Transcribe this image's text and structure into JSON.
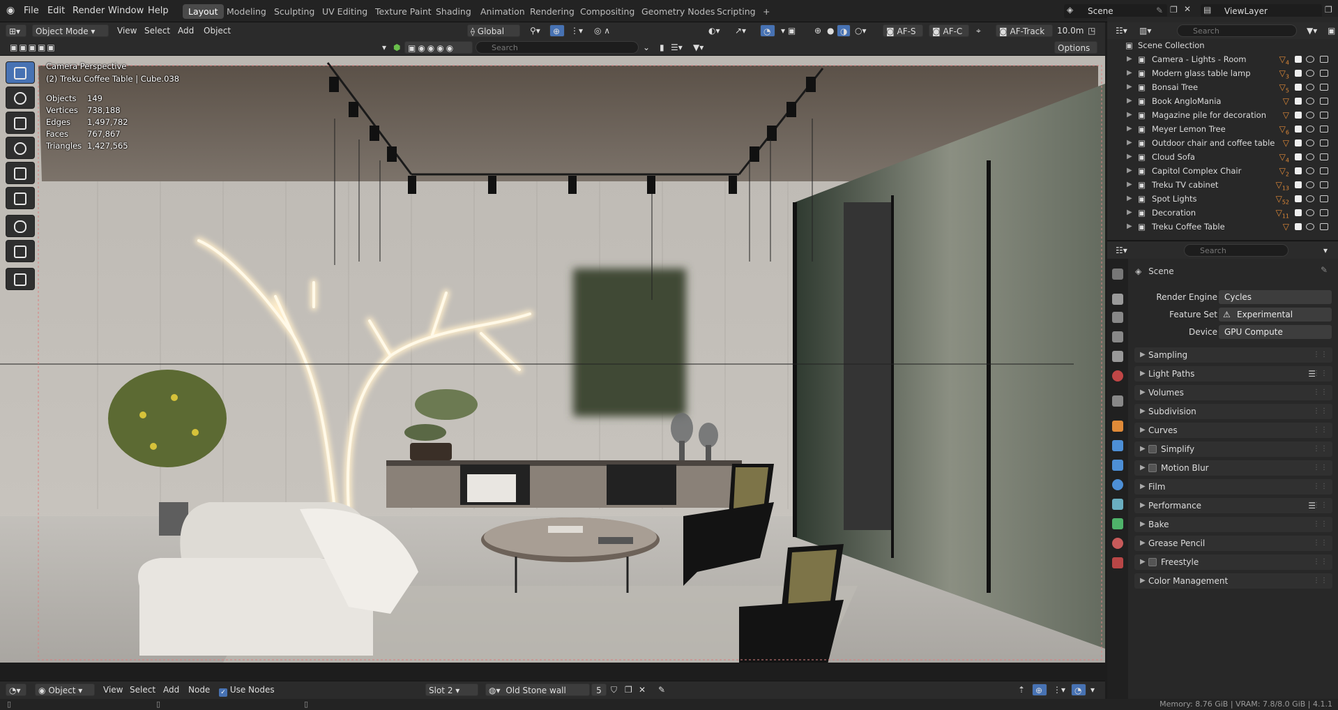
{
  "menu": {
    "file": "File",
    "edit": "Edit",
    "render": "Render",
    "window": "Window",
    "help": "Help"
  },
  "workspaces": [
    "Layout",
    "Modeling",
    "Sculpting",
    "UV Editing",
    "Texture Paint",
    "Shading",
    "Animation",
    "Rendering",
    "Compositing",
    "Geometry Nodes",
    "Scripting"
  ],
  "workspace_add": "+",
  "scene": {
    "label": "Scene",
    "viewlayer": "ViewLayer"
  },
  "viewport_header": {
    "mode": "Object Mode",
    "view": "View",
    "select": "Select",
    "add": "Add",
    "object": "Object",
    "transform": "Global",
    "af_s": "AF-S",
    "af_c": "AF-C",
    "af_track": "AF-Track",
    "distance": "10.0m",
    "search_placeholder": "Search",
    "options": "Options"
  },
  "overlay_info": {
    "camera": "Camera Perspective",
    "active": "(2) Treku Coffee Table | Cube.038",
    "stats": [
      {
        "label": "Objects",
        "value": "149"
      },
      {
        "label": "Vertices",
        "value": "738,188"
      },
      {
        "label": "Edges",
        "value": "1,497,782"
      },
      {
        "label": "Faces",
        "value": "767,867"
      },
      {
        "label": "Triangles",
        "value": "1,427,565"
      }
    ]
  },
  "outliner": {
    "search_placeholder": "Search",
    "root": "Scene Collection",
    "items": [
      {
        "name": "Camera - Lights - Room",
        "badge": "4"
      },
      {
        "name": "Modern glass table lamp",
        "badge": "3"
      },
      {
        "name": "Bonsai Tree",
        "badge": "5"
      },
      {
        "name": "Book AngloMania",
        "badge": ""
      },
      {
        "name": "Magazine pile for decoration",
        "badge": ""
      },
      {
        "name": "Meyer Lemon Tree",
        "badge": "6"
      },
      {
        "name": "Outdoor chair and coffee table",
        "badge": ""
      },
      {
        "name": "Cloud Sofa",
        "badge": "4"
      },
      {
        "name": "Capitol Complex Chair",
        "badge": "2"
      },
      {
        "name": "Treku TV cabinet",
        "badge": "13"
      },
      {
        "name": "Spot Lights",
        "badge": "52"
      },
      {
        "name": "Decoration",
        "badge": "11"
      },
      {
        "name": "Treku Coffee Table",
        "badge": ""
      }
    ]
  },
  "properties": {
    "search_placeholder": "Search",
    "context": "Scene",
    "fields": [
      {
        "label": "Render Engine",
        "value": "Cycles"
      },
      {
        "label": "Feature Set",
        "value": "Experimental"
      },
      {
        "label": "Device",
        "value": "GPU Compute"
      }
    ],
    "panels": [
      {
        "name": "Sampling",
        "check": false,
        "list": false
      },
      {
        "name": "Light Paths",
        "check": false,
        "list": true
      },
      {
        "name": "Volumes",
        "check": false,
        "list": false
      },
      {
        "name": "Subdivision",
        "check": false,
        "list": false
      },
      {
        "name": "Curves",
        "check": false,
        "list": false
      },
      {
        "name": "Simplify",
        "check": true,
        "list": false
      },
      {
        "name": "Motion Blur",
        "check": true,
        "list": false
      },
      {
        "name": "Film",
        "check": false,
        "list": false
      },
      {
        "name": "Performance",
        "check": false,
        "list": true
      },
      {
        "name": "Bake",
        "check": false,
        "list": false
      },
      {
        "name": "Grease Pencil",
        "check": false,
        "list": false
      },
      {
        "name": "Freestyle",
        "check": true,
        "list": false
      },
      {
        "name": "Color Management",
        "check": false,
        "list": false
      }
    ]
  },
  "shader_header": {
    "object": "Object",
    "view": "View",
    "select": "Select",
    "add": "Add",
    "node": "Node",
    "use_nodes": "Use Nodes",
    "slot": "Slot 2",
    "material": "Old Stone wall",
    "users": "5"
  },
  "status": {
    "memory": "Memory: 8.76 GiB | VRAM: 7.8/8.0 GiB | 4.1.1"
  },
  "colors": {
    "accent": "#4772b3",
    "object_orange": "#e08a38",
    "panel": "#303030"
  }
}
